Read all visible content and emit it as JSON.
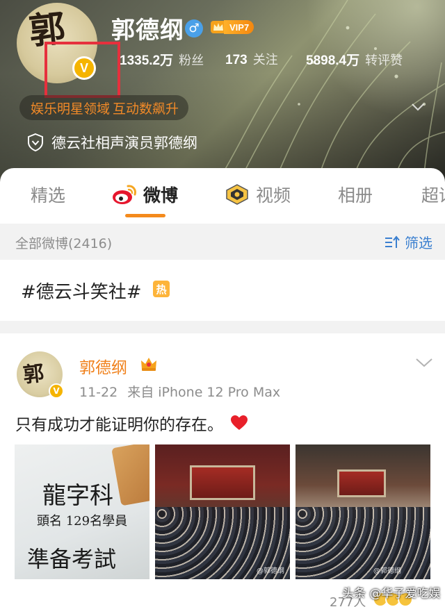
{
  "profile": {
    "name": "郭德纲",
    "gender_symbol": "♂",
    "vip_label": "VIP7",
    "verified_badge": "V",
    "avatar_glyph": "郭",
    "stats": [
      {
        "num": "1335.2万",
        "label": "粉丝"
      },
      {
        "num": "173",
        "label": "关注"
      },
      {
        "num": "5898.4万",
        "label": "转评赞"
      }
    ],
    "cert": {
      "field": "娱乐明星领域",
      "rank": "互动数飙升"
    },
    "bio": "德云社相声演员郭德纲"
  },
  "tabs": [
    {
      "label": "精选",
      "active": false
    },
    {
      "label": "微博",
      "active": true
    },
    {
      "label": "视频",
      "active": false
    },
    {
      "label": "相册",
      "active": false
    },
    {
      "label": "超话",
      "active": false
    }
  ],
  "filter": {
    "all_label": "全部微博(2416)",
    "filter_label": "筛选"
  },
  "topic": {
    "text": "#德云斗笑社#",
    "badge": "热"
  },
  "post": {
    "author": "郭德纲",
    "date": "11-22",
    "source": "来自 iPhone 12 Pro Max",
    "text": "只有成功才能证明你的存在。",
    "image1_calligraphy": [
      "龍字科",
      "頭名 129名學員",
      "準备考試"
    ],
    "image_watermark": "@郭德纲",
    "reads": "277人"
  },
  "watermark": "头条 @华子爱吃娱",
  "colors": {
    "accent": "#f48a1c",
    "link": "#3a7fd0",
    "vip": "#f3870f",
    "verified": "#f5b400",
    "highlight": "#e6303d"
  }
}
